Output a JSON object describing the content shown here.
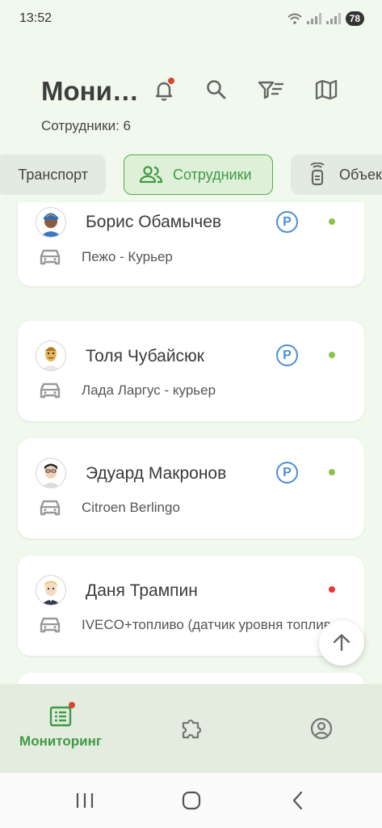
{
  "status_bar": {
    "time": "13:52",
    "battery": "78"
  },
  "header": {
    "title": "Мони…",
    "subtitle": "Сотрудники: 6"
  },
  "icons": {
    "bell": "bell-icon",
    "search": "search-icon",
    "filter": "filter-icon",
    "map": "map-icon"
  },
  "tabs": [
    {
      "label": "Транспорт",
      "active": false
    },
    {
      "label": "Сотрудники",
      "active": true
    },
    {
      "label": "Объекты",
      "active": false
    }
  ],
  "employees": [
    {
      "name": "Борис Обамычев",
      "vehicle": "Пежо - Курьер",
      "parking": "P",
      "status_color": "#8bc34a"
    },
    {
      "name": "Толя Чубайсюк",
      "vehicle": "Лада Ларгус - курьер",
      "parking": "P",
      "status_color": "#8bc34a"
    },
    {
      "name": "Эдуард Макронов",
      "vehicle": "Citroen Berlingo",
      "parking": "P",
      "status_color": "#8bc34a"
    },
    {
      "name": "Даня Трампин",
      "vehicle": "IVECO+топливо (датчик уровня топлива)",
      "status_color": "#e53935"
    }
  ],
  "bottom_nav": {
    "monitoring_label": "Мониторинг"
  },
  "colors": {
    "accent": "#3f9a44",
    "parking": "#4a8fd3",
    "alert": "#d9462f"
  }
}
